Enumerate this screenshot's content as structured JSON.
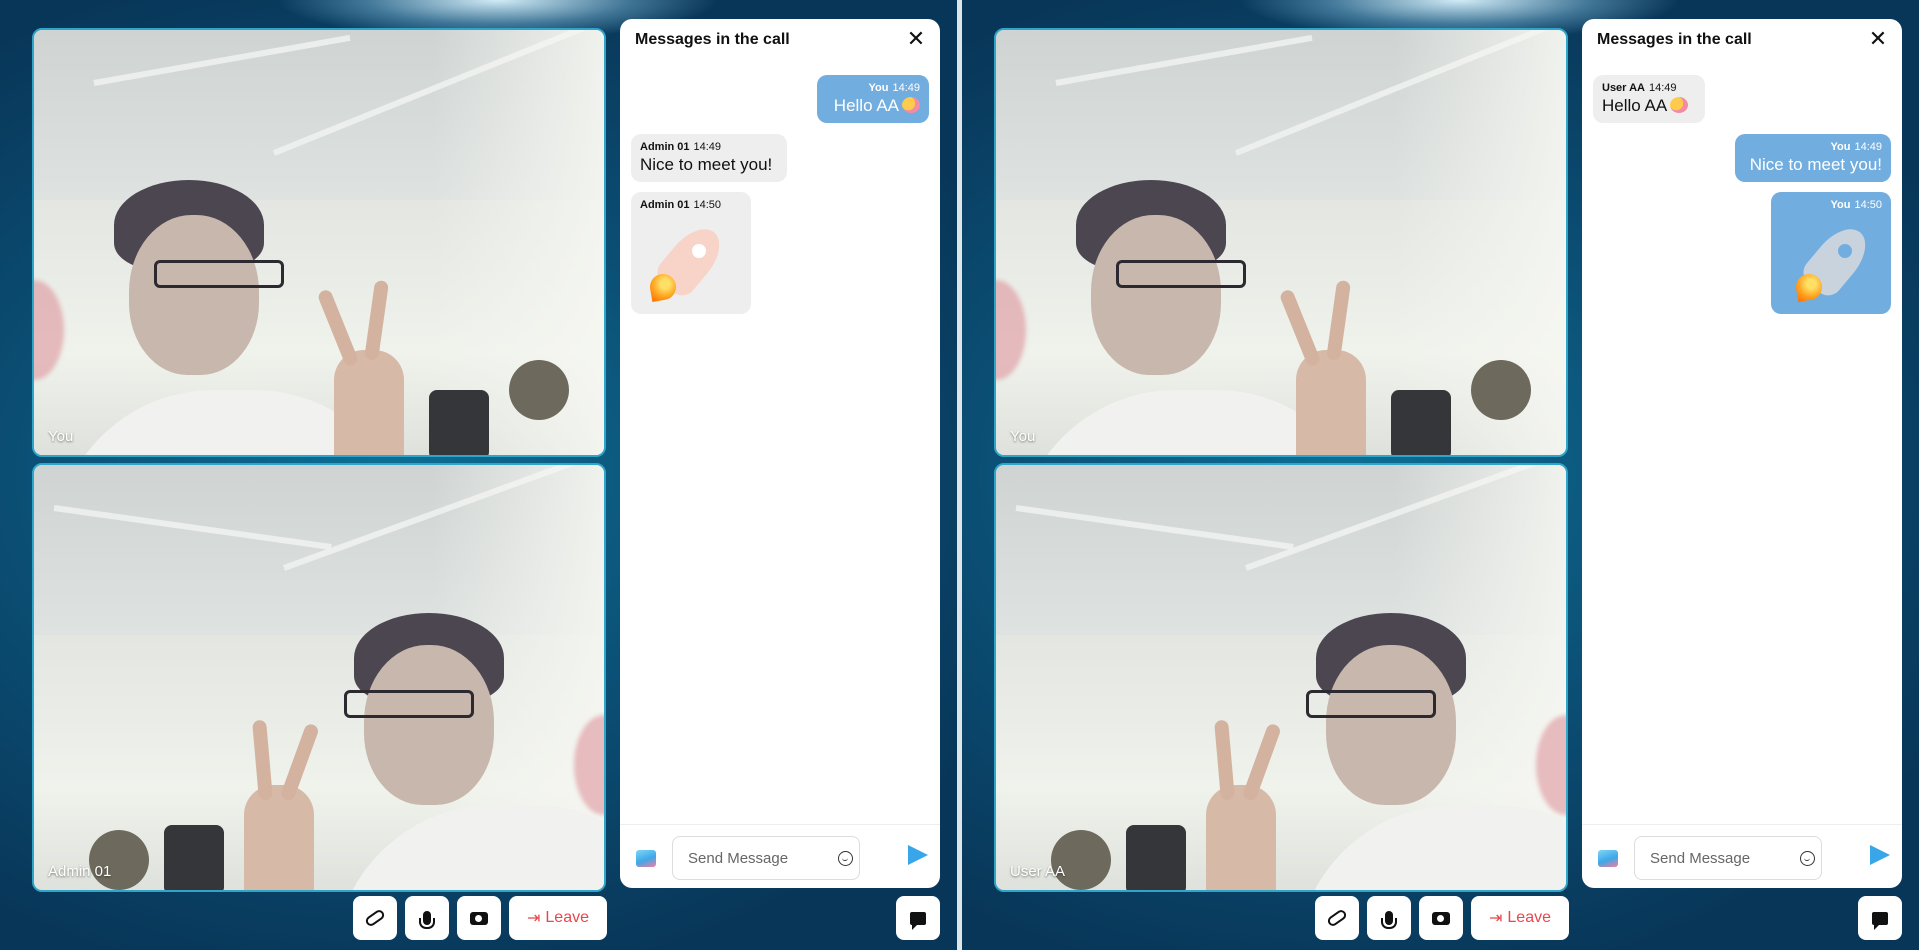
{
  "colors": {
    "accent_blue": "#72ade0",
    "send_blue": "#38a6e8",
    "leave_red": "#e5484d",
    "tile_border": "#2fa6c9",
    "background_dark": "#0b4d73"
  },
  "left_pane": {
    "video_top_label": "You",
    "video_bottom_label": "Admin 01",
    "chat": {
      "title": "Messages in the call",
      "messages": [
        {
          "side": "me",
          "sender": "You",
          "time": "14:49",
          "text": "Hello AA",
          "emoji": "smiling-face-with-hearts"
        },
        {
          "side": "other",
          "sender": "Admin 01",
          "time": "14:49",
          "text": "Nice to meet you!"
        },
        {
          "side": "other",
          "sender": "Admin 01",
          "time": "14:50",
          "sticker": "rocket"
        }
      ],
      "input_placeholder": "Send Message"
    },
    "toolbar": {
      "leave_label": "Leave"
    }
  },
  "right_pane": {
    "video_top_label": "You",
    "video_bottom_label": "User AA",
    "chat": {
      "title": "Messages in the call",
      "messages": [
        {
          "side": "other",
          "sender": "User AA",
          "time": "14:49",
          "text": "Hello AA",
          "emoji": "smiling-face-with-hearts"
        },
        {
          "side": "me",
          "sender": "You",
          "time": "14:49",
          "text": "Nice to meet you!"
        },
        {
          "side": "me",
          "sender": "You",
          "time": "14:50",
          "sticker": "rocket"
        }
      ],
      "input_placeholder": "Send Message"
    },
    "toolbar": {
      "leave_label": "Leave"
    }
  }
}
